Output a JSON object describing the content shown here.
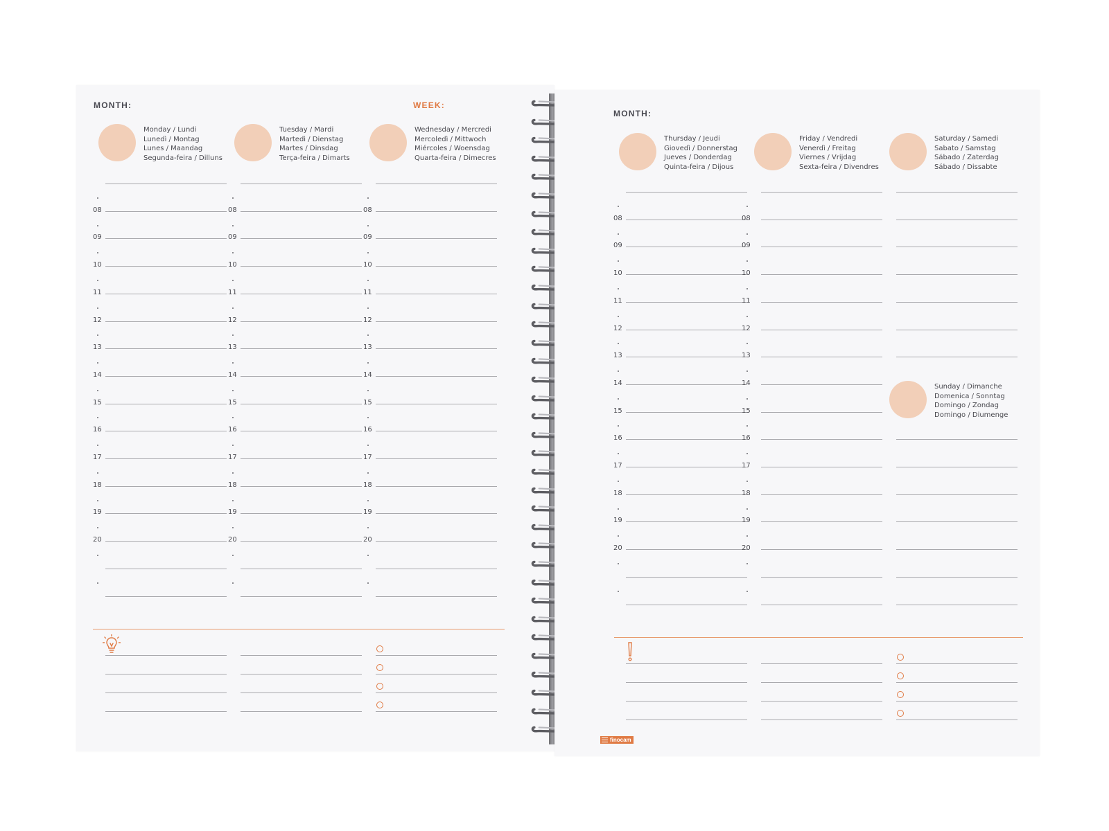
{
  "colors": {
    "accent": "#e07b45",
    "day_circle": "#f2cfb8",
    "paper": "#f7f7f9",
    "line": "#a9a9ad",
    "text": "#4a4a50"
  },
  "left_page": {
    "month_label": "MONTH:",
    "week_label": "WEEK:",
    "days": [
      {
        "names": "Monday / Lundi\nLunedì / Montag\nLunes / Maandag\nSegunda-feira / Dilluns"
      },
      {
        "names": "Tuesday / Mardi\nMartedì / Dienstag\nMartes / Dinsdag\nTerça-feira / Dimarts"
      },
      {
        "names": "Wednesday / Mercredi\nMercoledì / Mittwoch\nMiércoles / Woensdag\nQuarta-feira / Dimecres"
      }
    ],
    "notes_icon": "lightbulb-icon"
  },
  "right_page": {
    "month_label": "MONTH:",
    "days": [
      {
        "names": "Thursday / Jeudi\nGiovedì / Donnerstag\nJueves / Donderdag\nQuinta-feira / Dijous"
      },
      {
        "names": "Friday / Vendredi\nVenerdì / Freitag\nViernes / Vrijdag\nSexta-feira / Divendres"
      },
      {
        "names": "Saturday / Samedi\nSabato / Samstag\nSábado / Zaterdag\nSábado / Dissabte"
      },
      {
        "names": "Sunday / Dimanche\nDomenica / Sonntag\nDomingo / Zondag\nDomingo / Diumenge"
      }
    ],
    "notes_icon": "exclamation-icon",
    "brand": "finocam"
  },
  "hours": [
    "08",
    "09",
    "10",
    "11",
    "12",
    "13",
    "14",
    "15",
    "16",
    "17",
    "18",
    "19",
    "20"
  ]
}
